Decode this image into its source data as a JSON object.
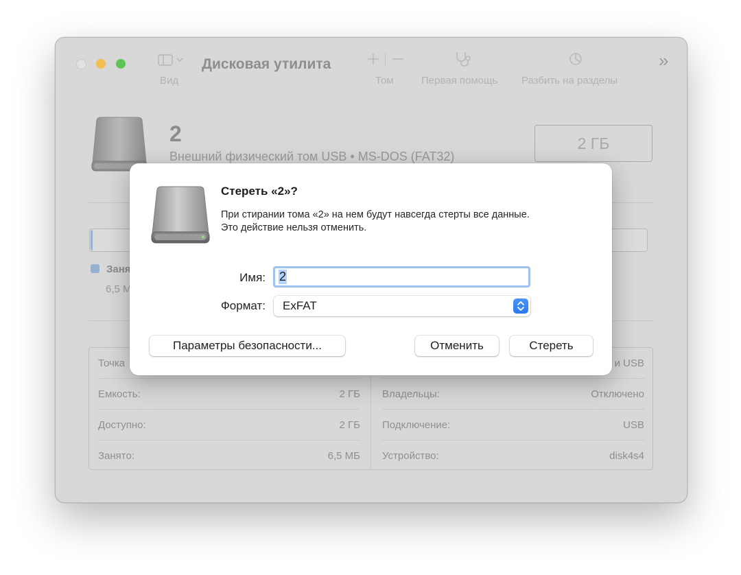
{
  "window": {
    "app_title": "Дисковая утилита",
    "toolbar": {
      "view_label": "Вид",
      "volume_label": "Том",
      "first_aid_label": "Первая помощь",
      "partition_label": "Разбить на разделы",
      "more_glyph": "»"
    },
    "disk": {
      "name": "2",
      "subtitle": "Внешний физический том USB • MS-DOS (FAT32)",
      "capacity": "2 ГБ"
    },
    "usage": {
      "used_label": "Заня",
      "used_value": "6,5 М",
      "used_fraction": 0.003
    },
    "info": {
      "left": [
        {
          "label": "Точка",
          "value": ""
        },
        {
          "label": "Емкость:",
          "value": "2 ГБ"
        },
        {
          "label": "Доступно:",
          "value": "2 ГБ"
        },
        {
          "label": "Занято:",
          "value": "6,5 МБ"
        }
      ],
      "right": [
        {
          "label": "",
          "value": "и USB"
        },
        {
          "label": "Владельцы:",
          "value": "Отключено"
        },
        {
          "label": "Подключение:",
          "value": "USB"
        },
        {
          "label": "Устройство:",
          "value": "disk4s4"
        }
      ]
    }
  },
  "sheet": {
    "title": "Стереть «2»?",
    "message_line1": "При стирании тома «2» на нем будут навсегда стерты все данные.",
    "message_line2": "Это действие нельзя отменить.",
    "name_label": "Имя:",
    "name_value": "2",
    "format_label": "Формат:",
    "format_value": "ExFAT",
    "security_button": "Параметры безопасности...",
    "cancel_button": "Отменить",
    "erase_button": "Стереть"
  },
  "colors": {
    "accent": "#2a78f0",
    "traffic_minimize": "#f4bd4f",
    "traffic_maximize": "#5fc454",
    "used_legend": "#97b0cf"
  },
  "icons": {
    "sidebar_toggle": "sidebar-icon",
    "add_volume": "plus-icon",
    "remove_volume": "minus-icon",
    "first_aid": "stethoscope-icon",
    "partition": "pie-chart-icon",
    "more": "chevron-double-right-icon",
    "disk": "external-disk-icon",
    "select_stepper": "updown-chevron-icon"
  }
}
